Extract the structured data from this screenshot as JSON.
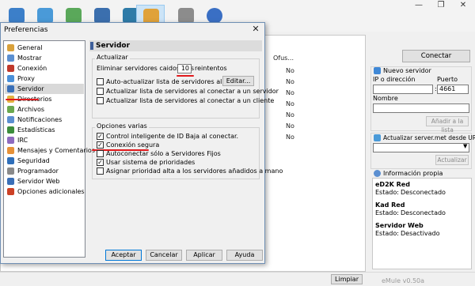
{
  "app": {
    "window_controls": [
      "—",
      "❐",
      "✕"
    ],
    "toolbar_icons": [
      "connect-icon",
      "servers-icon",
      "transfers-icon",
      "search-icon",
      "statistics-icon",
      "preferences-icon",
      "tools-icon",
      "help-icon"
    ],
    "colors": {
      "accent_blue": "#0078d7",
      "selection_gray": "#d9d9d9",
      "annotation_red": "#e1191c",
      "toolbar_active": "#cce4f7"
    }
  },
  "background": {
    "column_header": "Ofus...",
    "rows": [
      "No",
      "No",
      "No",
      "No",
      "No",
      "No",
      "No"
    ],
    "connect_button": "Conectar",
    "new_server": {
      "title": "Nuevo servidor",
      "ip_label": "IP o dirección",
      "port_label": "Puerto",
      "port_value": "4661",
      "name_label": "Nombre",
      "add_button": "Añadir a la lista"
    },
    "update_server_met": {
      "title": "Actualizar server.met desde URL",
      "update_button": "Actualizar"
    },
    "own_info": {
      "title": "Información propia",
      "entries": [
        {
          "name": "eD2K Red",
          "state_label": "Estado:",
          "state": "Desconectado"
        },
        {
          "name": "Kad Red",
          "state_label": "Estado:",
          "state": "Desconectado"
        },
        {
          "name": "Servidor Web",
          "state_label": "Estado:",
          "state": "Desactivado"
        }
      ]
    },
    "clear_button": "Limpiar",
    "version": "eMule v0.50a"
  },
  "dialog": {
    "title": "Preferencias",
    "close": "✕",
    "nav_items": [
      {
        "label": "General",
        "icon": "general-icon",
        "color": "#d9a13b"
      },
      {
        "label": "Mostrar",
        "icon": "display-icon",
        "color": "#5b8fd1"
      },
      {
        "label": "Conexión",
        "icon": "connection-icon",
        "color": "#c0392b"
      },
      {
        "label": "Proxy",
        "icon": "proxy-icon",
        "color": "#4a90d9"
      },
      {
        "label": "Servidor",
        "icon": "server-icon",
        "color": "#3a6fb7"
      },
      {
        "label": "Directorios",
        "icon": "folder-icon",
        "color": "#e3b341"
      },
      {
        "label": "Archivos",
        "icon": "files-icon",
        "color": "#6aa84f"
      },
      {
        "label": "Notificaciones",
        "icon": "notifications-icon",
        "color": "#5b8fd1"
      },
      {
        "label": "Estadísticas",
        "icon": "statistics-icon",
        "color": "#3c8d3c"
      },
      {
        "label": "IRC",
        "icon": "irc-icon",
        "color": "#8e6bbf"
      },
      {
        "label": "Mensajes y Comentarios",
        "icon": "messages-icon",
        "color": "#e69138"
      },
      {
        "label": "Seguridad",
        "icon": "security-icon",
        "color": "#2f6fba"
      },
      {
        "label": "Programador",
        "icon": "scheduler-icon",
        "color": "#8a8a8a"
      },
      {
        "label": "Servidor Web",
        "icon": "webserver-icon",
        "color": "#3a6fb7"
      },
      {
        "label": "Opciones adicionales",
        "icon": "advanced-icon",
        "color": "#cc4125"
      }
    ],
    "selected_nav": "Servidor",
    "panel_title": "Servidor",
    "update_group": {
      "title": "Actualizar",
      "remove_prefix": "Eliminar servidores caidos tras",
      "remove_value": "10",
      "remove_suffix": "reintentos",
      "auto_update": {
        "label": "Auto-actualizar lista de servidores al iniciar",
        "checked": false
      },
      "edit_button": "Editar...",
      "update_on_server": {
        "label": "Actualizar lista de servidores al conectar a un servidor",
        "checked": false
      },
      "update_on_client": {
        "label": "Actualizar lista de servidores al conectar a un cliente",
        "checked": false
      }
    },
    "misc_group": {
      "title": "Opciones varias",
      "options": [
        {
          "label": "Control inteligente de ID Baja al conectar.",
          "checked": true
        },
        {
          "label": "Conexión segura",
          "checked": true
        },
        {
          "label": "Autoconectar sólo a Servidores Fijos",
          "checked": false
        },
        {
          "label": "Usar sistema de prioridades",
          "checked": true
        },
        {
          "label": "Asignar prioridad alta a los servidores añadidos a mano",
          "checked": false
        }
      ]
    },
    "buttons": {
      "accept": "Aceptar",
      "cancel": "Cancelar",
      "apply": "Aplicar",
      "help": "Ayuda"
    }
  }
}
